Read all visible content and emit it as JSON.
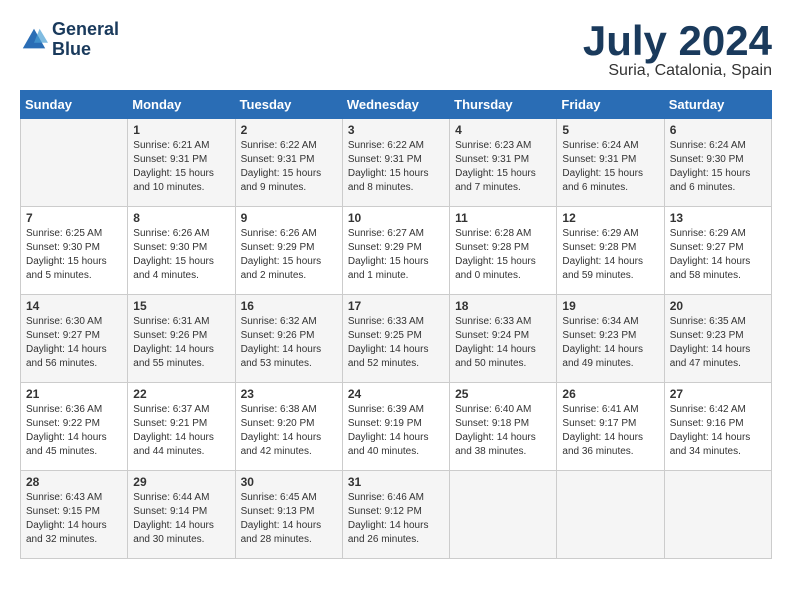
{
  "logo": {
    "line1": "General",
    "line2": "Blue"
  },
  "title": "July 2024",
  "subtitle": "Suria, Catalonia, Spain",
  "header_days": [
    "Sunday",
    "Monday",
    "Tuesday",
    "Wednesday",
    "Thursday",
    "Friday",
    "Saturday"
  ],
  "weeks": [
    [
      {
        "day": "",
        "sunrise": "",
        "sunset": "",
        "daylight": ""
      },
      {
        "day": "1",
        "sunrise": "Sunrise: 6:21 AM",
        "sunset": "Sunset: 9:31 PM",
        "daylight": "Daylight: 15 hours and 10 minutes."
      },
      {
        "day": "2",
        "sunrise": "Sunrise: 6:22 AM",
        "sunset": "Sunset: 9:31 PM",
        "daylight": "Daylight: 15 hours and 9 minutes."
      },
      {
        "day": "3",
        "sunrise": "Sunrise: 6:22 AM",
        "sunset": "Sunset: 9:31 PM",
        "daylight": "Daylight: 15 hours and 8 minutes."
      },
      {
        "day": "4",
        "sunrise": "Sunrise: 6:23 AM",
        "sunset": "Sunset: 9:31 PM",
        "daylight": "Daylight: 15 hours and 7 minutes."
      },
      {
        "day": "5",
        "sunrise": "Sunrise: 6:24 AM",
        "sunset": "Sunset: 9:31 PM",
        "daylight": "Daylight: 15 hours and 6 minutes."
      },
      {
        "day": "6",
        "sunrise": "Sunrise: 6:24 AM",
        "sunset": "Sunset: 9:30 PM",
        "daylight": "Daylight: 15 hours and 6 minutes."
      }
    ],
    [
      {
        "day": "7",
        "sunrise": "Sunrise: 6:25 AM",
        "sunset": "Sunset: 9:30 PM",
        "daylight": "Daylight: 15 hours and 5 minutes."
      },
      {
        "day": "8",
        "sunrise": "Sunrise: 6:26 AM",
        "sunset": "Sunset: 9:30 PM",
        "daylight": "Daylight: 15 hours and 4 minutes."
      },
      {
        "day": "9",
        "sunrise": "Sunrise: 6:26 AM",
        "sunset": "Sunset: 9:29 PM",
        "daylight": "Daylight: 15 hours and 2 minutes."
      },
      {
        "day": "10",
        "sunrise": "Sunrise: 6:27 AM",
        "sunset": "Sunset: 9:29 PM",
        "daylight": "Daylight: 15 hours and 1 minute."
      },
      {
        "day": "11",
        "sunrise": "Sunrise: 6:28 AM",
        "sunset": "Sunset: 9:28 PM",
        "daylight": "Daylight: 15 hours and 0 minutes."
      },
      {
        "day": "12",
        "sunrise": "Sunrise: 6:29 AM",
        "sunset": "Sunset: 9:28 PM",
        "daylight": "Daylight: 14 hours and 59 minutes."
      },
      {
        "day": "13",
        "sunrise": "Sunrise: 6:29 AM",
        "sunset": "Sunset: 9:27 PM",
        "daylight": "Daylight: 14 hours and 58 minutes."
      }
    ],
    [
      {
        "day": "14",
        "sunrise": "Sunrise: 6:30 AM",
        "sunset": "Sunset: 9:27 PM",
        "daylight": "Daylight: 14 hours and 56 minutes."
      },
      {
        "day": "15",
        "sunrise": "Sunrise: 6:31 AM",
        "sunset": "Sunset: 9:26 PM",
        "daylight": "Daylight: 14 hours and 55 minutes."
      },
      {
        "day": "16",
        "sunrise": "Sunrise: 6:32 AM",
        "sunset": "Sunset: 9:26 PM",
        "daylight": "Daylight: 14 hours and 53 minutes."
      },
      {
        "day": "17",
        "sunrise": "Sunrise: 6:33 AM",
        "sunset": "Sunset: 9:25 PM",
        "daylight": "Daylight: 14 hours and 52 minutes."
      },
      {
        "day": "18",
        "sunrise": "Sunrise: 6:33 AM",
        "sunset": "Sunset: 9:24 PM",
        "daylight": "Daylight: 14 hours and 50 minutes."
      },
      {
        "day": "19",
        "sunrise": "Sunrise: 6:34 AM",
        "sunset": "Sunset: 9:23 PM",
        "daylight": "Daylight: 14 hours and 49 minutes."
      },
      {
        "day": "20",
        "sunrise": "Sunrise: 6:35 AM",
        "sunset": "Sunset: 9:23 PM",
        "daylight": "Daylight: 14 hours and 47 minutes."
      }
    ],
    [
      {
        "day": "21",
        "sunrise": "Sunrise: 6:36 AM",
        "sunset": "Sunset: 9:22 PM",
        "daylight": "Daylight: 14 hours and 45 minutes."
      },
      {
        "day": "22",
        "sunrise": "Sunrise: 6:37 AM",
        "sunset": "Sunset: 9:21 PM",
        "daylight": "Daylight: 14 hours and 44 minutes."
      },
      {
        "day": "23",
        "sunrise": "Sunrise: 6:38 AM",
        "sunset": "Sunset: 9:20 PM",
        "daylight": "Daylight: 14 hours and 42 minutes."
      },
      {
        "day": "24",
        "sunrise": "Sunrise: 6:39 AM",
        "sunset": "Sunset: 9:19 PM",
        "daylight": "Daylight: 14 hours and 40 minutes."
      },
      {
        "day": "25",
        "sunrise": "Sunrise: 6:40 AM",
        "sunset": "Sunset: 9:18 PM",
        "daylight": "Daylight: 14 hours and 38 minutes."
      },
      {
        "day": "26",
        "sunrise": "Sunrise: 6:41 AM",
        "sunset": "Sunset: 9:17 PM",
        "daylight": "Daylight: 14 hours and 36 minutes."
      },
      {
        "day": "27",
        "sunrise": "Sunrise: 6:42 AM",
        "sunset": "Sunset: 9:16 PM",
        "daylight": "Daylight: 14 hours and 34 minutes."
      }
    ],
    [
      {
        "day": "28",
        "sunrise": "Sunrise: 6:43 AM",
        "sunset": "Sunset: 9:15 PM",
        "daylight": "Daylight: 14 hours and 32 minutes."
      },
      {
        "day": "29",
        "sunrise": "Sunrise: 6:44 AM",
        "sunset": "Sunset: 9:14 PM",
        "daylight": "Daylight: 14 hours and 30 minutes."
      },
      {
        "day": "30",
        "sunrise": "Sunrise: 6:45 AM",
        "sunset": "Sunset: 9:13 PM",
        "daylight": "Daylight: 14 hours and 28 minutes."
      },
      {
        "day": "31",
        "sunrise": "Sunrise: 6:46 AM",
        "sunset": "Sunset: 9:12 PM",
        "daylight": "Daylight: 14 hours and 26 minutes."
      },
      {
        "day": "",
        "sunrise": "",
        "sunset": "",
        "daylight": ""
      },
      {
        "day": "",
        "sunrise": "",
        "sunset": "",
        "daylight": ""
      },
      {
        "day": "",
        "sunrise": "",
        "sunset": "",
        "daylight": ""
      }
    ]
  ]
}
